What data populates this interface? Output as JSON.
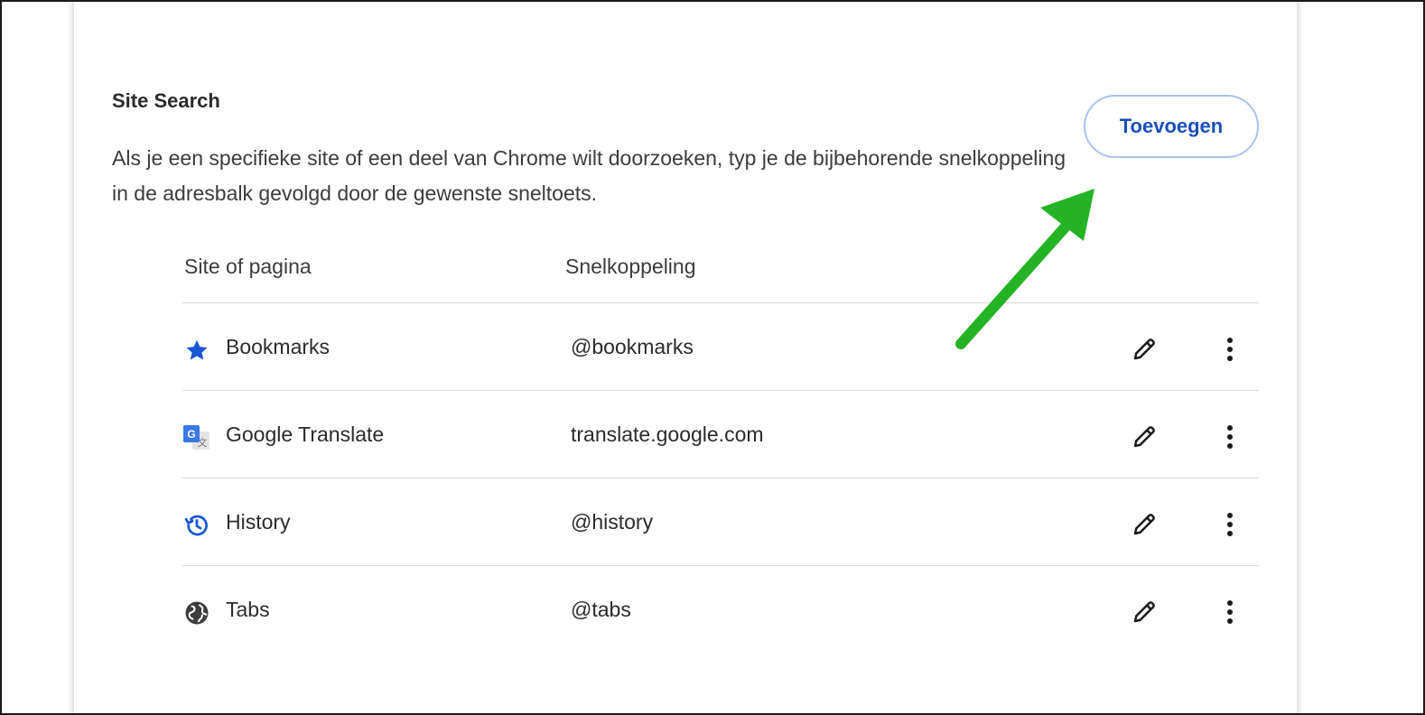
{
  "site_search": {
    "title": "Site Search",
    "description": "Als je een specifieke site of een deel van Chrome wilt doorzoeken, typ je de bijbehorende snelkoppeling in de adresbalk gevolgd door de gewenste sneltoets.",
    "add_label": "Toevoegen"
  },
  "table": {
    "headers": {
      "site": "Site of pagina",
      "shortcut": "Snelkoppeling"
    },
    "rows": [
      {
        "name": "Bookmarks",
        "shortcut": "@bookmarks",
        "icon": "star-icon"
      },
      {
        "name": "Google Translate",
        "shortcut": "translate.google.com",
        "icon": "google-translate-icon"
      },
      {
        "name": "History",
        "shortcut": "@history",
        "icon": "history-icon"
      },
      {
        "name": "Tabs",
        "shortcut": "@tabs",
        "icon": "globe-icon"
      }
    ]
  },
  "colors": {
    "accent_blue": "#1b4eb8",
    "button_border": "#a9c3f2",
    "icon_blue": "#1a57d6",
    "arrow_green": "#24b324"
  }
}
